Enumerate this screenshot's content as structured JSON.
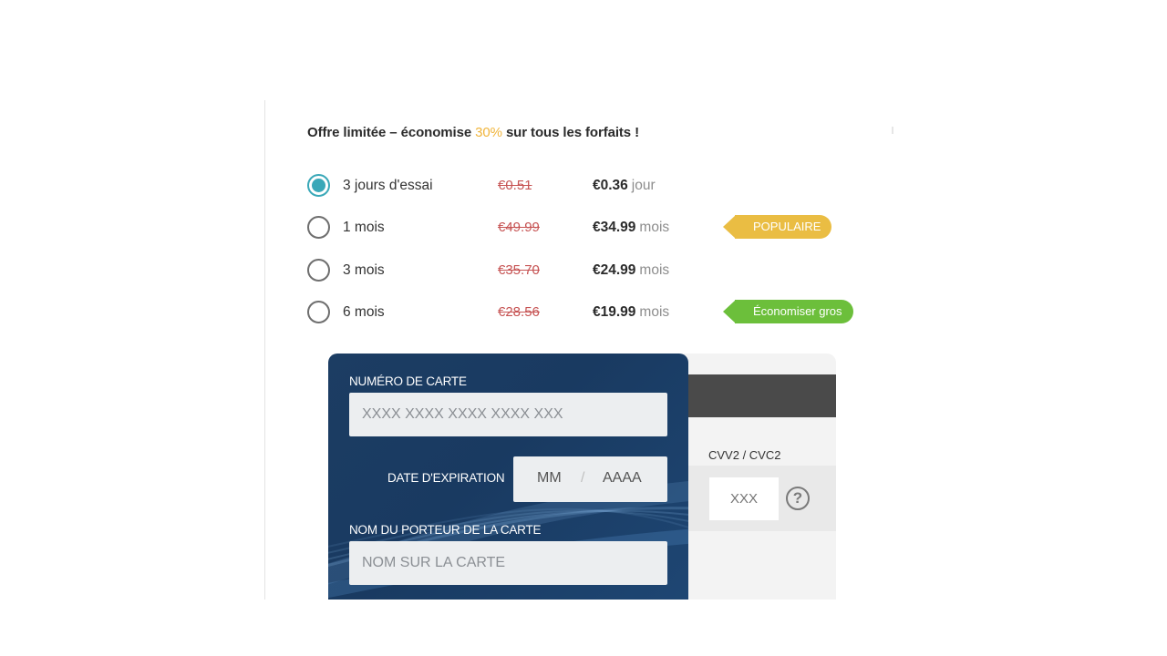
{
  "offer": {
    "prefix": "Offre limitée – économise ",
    "percent": "30%",
    "suffix": " sur tous les forfaits !"
  },
  "plans": [
    {
      "name": "3 jours d'essai",
      "old_price": "€0.51",
      "price": "€0.36",
      "period": "jour",
      "selected": true
    },
    {
      "name": "1 mois",
      "old_price": "€49.99",
      "price": "€34.99",
      "period": "mois",
      "selected": false,
      "tag": "POPULAIRE",
      "tag_color": "#eabd43"
    },
    {
      "name": "3 mois",
      "old_price": "€35.70",
      "price": "€24.99",
      "period": "mois",
      "selected": false
    },
    {
      "name": "6 mois",
      "old_price": "€28.56",
      "price": "€19.99",
      "period": "mois",
      "selected": false,
      "tag": "Économiser gros",
      "tag_color": "#6cbf3b"
    }
  ],
  "card": {
    "number_label": "NUMÉRO DE CARTE",
    "number_placeholder": "XXXX XXXX XXXX XXXX XXX",
    "expiry_label": "DATE D'EXPIRATION",
    "expiry_month": "MM",
    "expiry_sep": "/",
    "expiry_year": "AAAA",
    "holder_label": "NOM DU PORTEUR DE LA CARTE",
    "holder_placeholder": "NOM SUR LA CARTE",
    "cvv_label": "CVV2 / CVC2",
    "cvv_placeholder": "XXX",
    "help_icon": "?"
  },
  "colors": {
    "accent": "#3aa8b8",
    "strike": "#c65353",
    "card_bg": "#1c3d63"
  }
}
